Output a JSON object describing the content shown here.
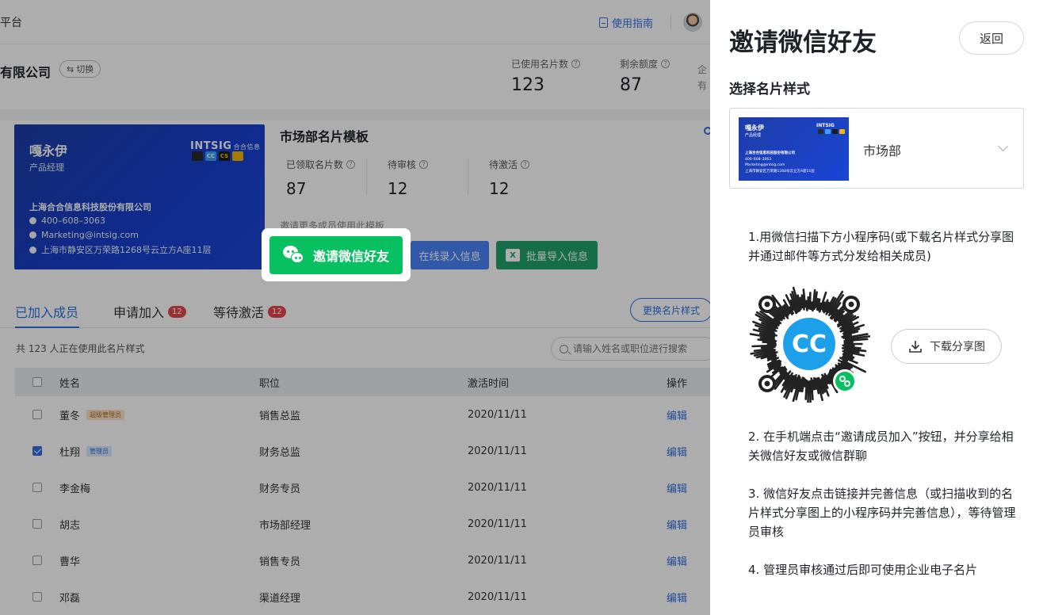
{
  "header": {
    "title_partial": "平台",
    "guide_label": "使用指南"
  },
  "company": {
    "name_partial": "有限公司",
    "switch_label": "切换",
    "stats": [
      {
        "label": "已使用名片数",
        "value": "123"
      },
      {
        "label": "剩余额度",
        "value": "87"
      }
    ],
    "stat_cut_line1": "企",
    "stat_cut_line2": "有"
  },
  "template": {
    "card": {
      "name": "嘎永伊",
      "role": "产品经理",
      "brand": "INTSIG",
      "brand_cn": "合合信息",
      "company": "上海合合信息科技股份有限公司",
      "phone": "400–608–3063",
      "email": "Marketing@intsig.com",
      "address": "上海市静安区万荣路1268号云立方A座11层",
      "logos": [
        "",
        "CC",
        "CS",
        ""
      ]
    },
    "title": "市场部名片模板",
    "stats": [
      {
        "label": "已领取名片数",
        "value": "87"
      },
      {
        "label": "待审核",
        "value": "12"
      },
      {
        "label": "待激活",
        "value": "12"
      }
    ],
    "invite_more": "邀请更多成员使用此模板",
    "invite_wechat_label": "邀请微信好友",
    "online_label": "在线录入信息",
    "batch_label": "批量导入信息",
    "excel_icon_letter": "X"
  },
  "tabs": {
    "items": [
      {
        "label": "已加入成员",
        "badge": ""
      },
      {
        "label": "申请加入",
        "badge": "12"
      },
      {
        "label": "等待激活",
        "badge": "12"
      }
    ],
    "change_style_label": "更换名片样式"
  },
  "list": {
    "count_text": "共 123 人正在使用此名片样式",
    "search_placeholder": "请输入姓名或职位进行搜索",
    "columns": [
      "姓名",
      "职位",
      "激活时间",
      "操作"
    ],
    "rows": [
      {
        "name": "董冬",
        "tag": "超级管理员",
        "tag_type": "super",
        "position": "销售总监",
        "time": "2020/11/11",
        "action": "编辑",
        "checked": false
      },
      {
        "name": "杜翔",
        "tag": "管理员",
        "tag_type": "admin",
        "position": "财务总监",
        "time": "2020/11/11",
        "action": "编辑",
        "checked": true
      },
      {
        "name": "李金梅",
        "tag": "",
        "tag_type": "",
        "position": "财务专员",
        "time": "2020/11/11",
        "action": "编辑",
        "checked": false
      },
      {
        "name": "胡志",
        "tag": "",
        "tag_type": "",
        "position": "市场部经理",
        "time": "2020/11/11",
        "action": "编辑",
        "checked": false
      },
      {
        "name": "曹华",
        "tag": "",
        "tag_type": "",
        "position": "销售专员",
        "time": "2020/11/11",
        "action": "编辑",
        "checked": false
      },
      {
        "name": "邓磊",
        "tag": "",
        "tag_type": "",
        "position": "渠道经理",
        "time": "2020/11/11",
        "action": "编辑",
        "checked": false
      }
    ]
  },
  "panel": {
    "title": "邀请微信好友",
    "back_label": "返回",
    "subtitle": "选择名片样式",
    "selected_style": "市场部",
    "mini_card": {
      "name": "嘎永伊",
      "role": "产品经理",
      "brand": "INTSIG",
      "company": "上海合合信息科技股份有限公司",
      "phone": "400–608–3063",
      "email": "Marketing@intsig.com",
      "address": "上海市静安区万荣路1268号云立方A座11层"
    },
    "step1": "1.用微信扫描下方小程序码(或下载名片样式分享图并通过邮件等方式分发给相关成员)",
    "download_label": "下载分享图",
    "step2": "2. 在手机端点击“邀请成员加入”按钮，并分享给相关微信好友或微信群聊",
    "step3": "3. 微信好友点击链接并完善信息（或扫描收到的名片样式分享图上的小程序码并完善信息），等待管理员审核",
    "step4": "4. 管理员审核通过后即可使用企业电子名片",
    "qr_center_text": "CC"
  },
  "colors": {
    "accent": "#2f6fe4",
    "wechat_green": "#07c160",
    "card_blue": "#1a45d6",
    "badge_red": "#e5484d"
  }
}
